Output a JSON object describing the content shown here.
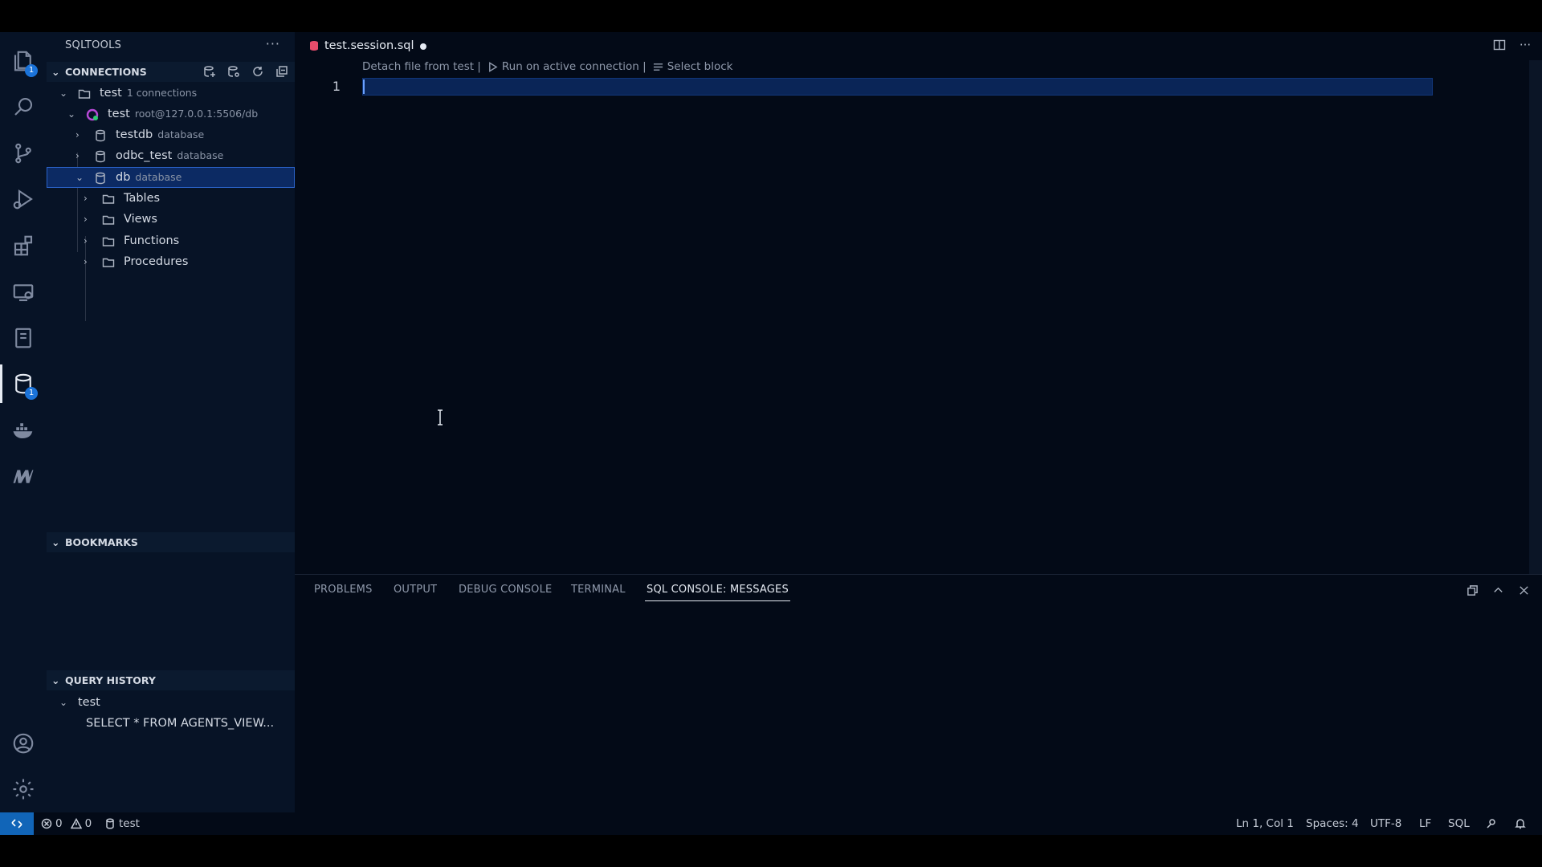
{
  "sidebar": {
    "title": "SQLTOOLS",
    "more_label": "···",
    "connections": {
      "label": "CONNECTIONS",
      "tree": [
        {
          "label": "test",
          "desc": "1 connections"
        },
        {
          "label": "test",
          "desc": "root@127.0.0.1:5506/db"
        },
        {
          "label": "testdb",
          "desc": "database"
        },
        {
          "label": "odbc_test",
          "desc": "database"
        },
        {
          "label": "db",
          "desc": "database"
        },
        {
          "label": "Tables"
        },
        {
          "label": "Views"
        },
        {
          "label": "Functions"
        },
        {
          "label": "Procedures"
        }
      ]
    },
    "bookmarks": {
      "label": "BOOKMARKS"
    },
    "query_history": {
      "label": "QUERY HISTORY",
      "items": [
        {
          "label": "test"
        },
        {
          "label": "SELECT * FROM AGENTS_VIEW..."
        }
      ]
    }
  },
  "activity_bar": {
    "explorer_badge": "1",
    "sqltools_badge": "1"
  },
  "editor": {
    "tab": {
      "name": "test.session.sql"
    },
    "codelens": {
      "detach": "Detach file from test |",
      "run": "Run on active connection |",
      "select": "Select block"
    },
    "line_number": "1"
  },
  "panel": {
    "tabs": [
      {
        "label": "PROBLEMS"
      },
      {
        "label": "OUTPUT"
      },
      {
        "label": "DEBUG CONSOLE"
      },
      {
        "label": "TERMINAL"
      },
      {
        "label": "SQL CONSOLE: MESSAGES"
      }
    ]
  },
  "statusbar": {
    "errors": "0",
    "warnings": "0",
    "connection": "test",
    "position": "Ln 1, Col 1",
    "spaces": "Spaces: 4",
    "encoding": "UTF-8",
    "eol": "LF",
    "language": "SQL"
  },
  "colors": {
    "background": "#030a17",
    "sidebar": "#071326",
    "selection": "#0c2a63",
    "accent": "#1165b8",
    "sql_file_icon": "#e64c6b"
  }
}
